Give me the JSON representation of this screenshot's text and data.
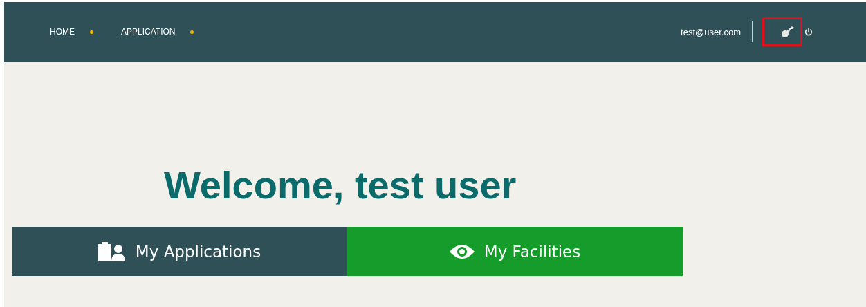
{
  "nav": {
    "items": [
      {
        "label": "HOME"
      },
      {
        "label": "APPLICATION"
      }
    ]
  },
  "user": {
    "email": "test@user.com"
  },
  "actions": [
    {
      "kind": "key",
      "highlighted": true
    },
    {
      "kind": "power",
      "highlighted": false
    }
  ],
  "welcome": "Welcome, test user",
  "tiles": [
    {
      "label": "My Applications",
      "kind": "applications",
      "color": "#2f5057"
    },
    {
      "label": "My Facilities",
      "kind": "facilities",
      "color": "#169c2a"
    }
  ]
}
